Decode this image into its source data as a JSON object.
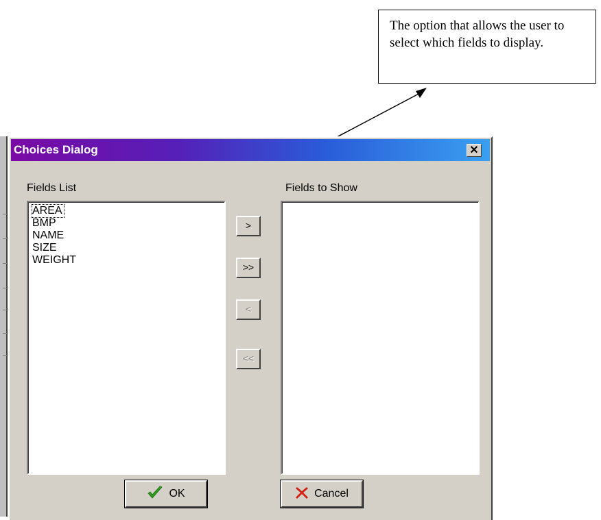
{
  "callout": {
    "text": "The option that allows the user to select which fields to display."
  },
  "dialog": {
    "title": "Choices Dialog",
    "close_glyph": "✕",
    "fields_list_label": "Fields List",
    "fields_to_show_label": "Fields to Show",
    "fields_list": [
      "AREA",
      "BMP",
      "NAME",
      "SIZE",
      "WEIGHT"
    ],
    "fields_to_show": [],
    "buttons": {
      "add_one": ">",
      "add_all": ">>",
      "remove_one": "<",
      "remove_all": "<<",
      "ok": "OK",
      "cancel": "Cancel"
    }
  },
  "colors": {
    "ok_icon": "#2e9e1e",
    "cancel_icon": "#d02010"
  },
  "icons": {
    "ok": "checkmark-icon",
    "cancel": "x-icon",
    "close": "close-icon"
  }
}
